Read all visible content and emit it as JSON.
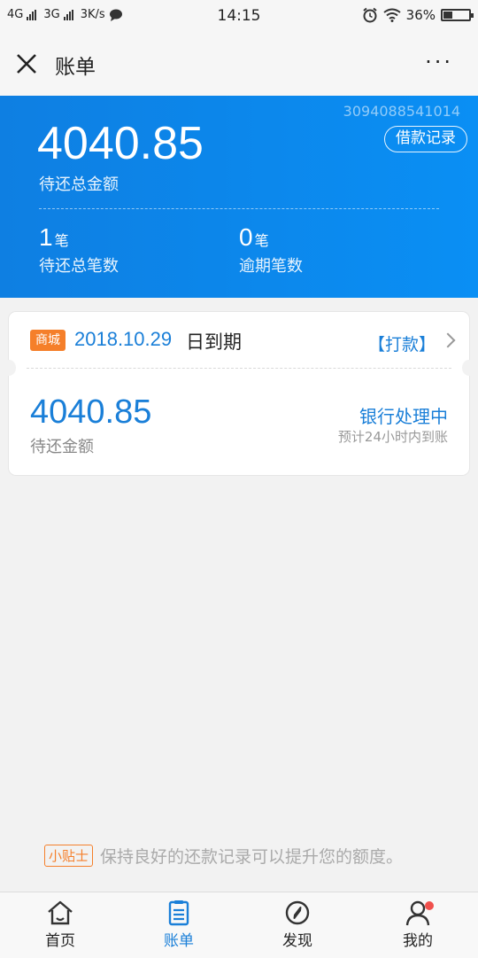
{
  "status_bar": {
    "network_1": "4G",
    "network_2": "3G",
    "speed": "3K/s",
    "time": "14:15",
    "battery": "36%",
    "battery_level": 0.36
  },
  "nav": {
    "title": "账单",
    "more": "···"
  },
  "summary": {
    "account_number": "3094088541014",
    "loan_record_label": "借款记录",
    "total_amount": "4040.85",
    "total_amount_label": "待还总金额",
    "pending_count": "1",
    "pending_unit": "笔",
    "pending_label": "待还总笔数",
    "overdue_count": "0",
    "overdue_unit": "笔",
    "overdue_label": "逾期笔数"
  },
  "bill": {
    "badge": "商城",
    "due_date": "2018.10.29",
    "due_suffix": "日到期",
    "action": "【打款】",
    "amount": "4040.85",
    "amount_label": "待还金额",
    "status": "银行处理中",
    "status_note": "预计24小时内到账"
  },
  "tip": {
    "badge": "小贴士",
    "text": "保持良好的还款记录可以提升您的额度。"
  },
  "tabs": [
    {
      "label": "首页",
      "icon": "home-icon"
    },
    {
      "label": "账单",
      "icon": "bill-icon",
      "active": true
    },
    {
      "label": "发现",
      "icon": "compass-icon"
    },
    {
      "label": "我的",
      "icon": "user-icon",
      "badge_dot": true
    }
  ],
  "colors": {
    "brand_blue": "#0a8ff4",
    "link_blue": "#1a7fd8",
    "accent_orange": "#f57f2a",
    "notice_red": "#f0504c"
  }
}
